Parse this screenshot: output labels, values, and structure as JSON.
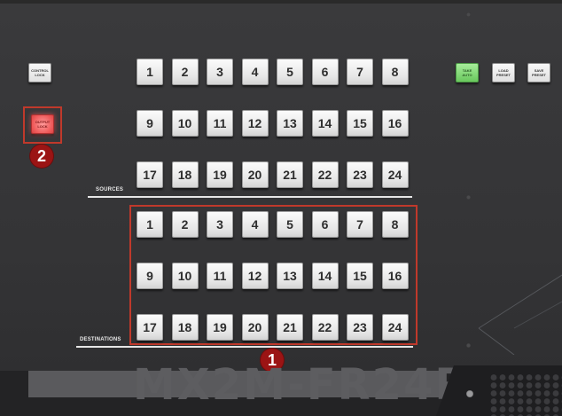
{
  "panel": {
    "model_text": "MX2M-FR24R",
    "sources_label": "SOURCES",
    "destinations_label": "DESTINATIONS"
  },
  "controls": {
    "control_lock": [
      "CONTROL",
      "LOCK"
    ],
    "output_lock": [
      "OUTPUT",
      "LOCK"
    ],
    "take_auto": [
      "TAKE",
      "AUTO"
    ],
    "load_preset": [
      "LOAD",
      "PRESET"
    ],
    "save_preset": [
      "SAVE",
      "PRESET"
    ]
  },
  "sources": [
    "1",
    "2",
    "3",
    "4",
    "5",
    "6",
    "7",
    "8",
    "9",
    "10",
    "11",
    "12",
    "13",
    "14",
    "15",
    "16",
    "17",
    "18",
    "19",
    "20",
    "21",
    "22",
    "23",
    "24"
  ],
  "destinations": [
    "1",
    "2",
    "3",
    "4",
    "5",
    "6",
    "7",
    "8",
    "9",
    "10",
    "11",
    "12",
    "13",
    "14",
    "15",
    "16",
    "17",
    "18",
    "19",
    "20",
    "21",
    "22",
    "23",
    "24"
  ],
  "annotations": {
    "badge_1": "1",
    "badge_2": "2",
    "highlight_color": "#c0392b"
  },
  "colors": {
    "take_button": "#7ed872",
    "output_lock_button": "#ef6a6a",
    "badge": "#9b1414"
  }
}
